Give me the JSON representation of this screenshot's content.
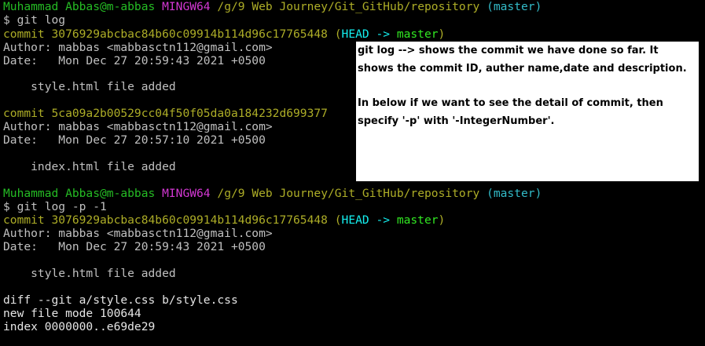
{
  "colors": {
    "background": "#000000",
    "user_host": "#25bc24",
    "mingw": "#d338d3",
    "path": "#adad27",
    "branch": "#33bbc8",
    "head": "#14f0f0",
    "master_ref": "#31e722",
    "text": "#c0c0c0",
    "note_bg": "#ffffff"
  },
  "prompt1": {
    "user_host": "Muhammad Abbas@m-abbas",
    "env": "MINGW64",
    "path": "/g/9 Web Journey/Git_GitHub/repository",
    "branch": "(master)",
    "command": "$ git log"
  },
  "log1": [
    {
      "commit_label": "commit 3076929abcbac84b60c09914b114d96c17765448",
      "ref_open": " (",
      "ref_head": "HEAD -> ",
      "ref_master": "master",
      "ref_close": ")",
      "author": "Author: mabbas <mabbasctn112@gmail.com>",
      "date": "Date:   Mon Dec 27 20:59:43 2021 +0500",
      "message": "    style.html file added"
    },
    {
      "commit_label": "commit 5ca09a2b00529cc04f50f05da0a184232d699377",
      "author": "Author: mabbas <mabbasctn112@gmail.com>",
      "date": "Date:   Mon Dec 27 20:57:10 2021 +0500",
      "message": "    index.html file added"
    }
  ],
  "prompt2": {
    "user_host": "Muhammad Abbas@m-abbas",
    "env": "MINGW64",
    "path": "/g/9 Web Journey/Git_GitHub/repository",
    "branch": "(master)",
    "command": "$ git log -p -1"
  },
  "log2": {
    "commit_label": "commit 3076929abcbac84b60c09914b114d96c17765448",
    "ref_open": " (",
    "ref_head": "HEAD -> ",
    "ref_master": "master",
    "ref_close": ")",
    "author": "Author: mabbas <mabbasctn112@gmail.com>",
    "date": "Date:   Mon Dec 27 20:59:43 2021 +0500",
    "message": "    style.html file added",
    "diff_header": "diff --git a/style.css b/style.css",
    "file_mode": "new file mode 100644",
    "index": "index 0000000..e69de29"
  },
  "note": {
    "line1": "git log --> shows the commit we have done so far. It",
    "line2": "shows the commit ID, auther name,date and description.",
    "line3": "In below if we want to see the detail of commit, then",
    "line4": "specify '-p' with '-IntegerNumber'."
  }
}
